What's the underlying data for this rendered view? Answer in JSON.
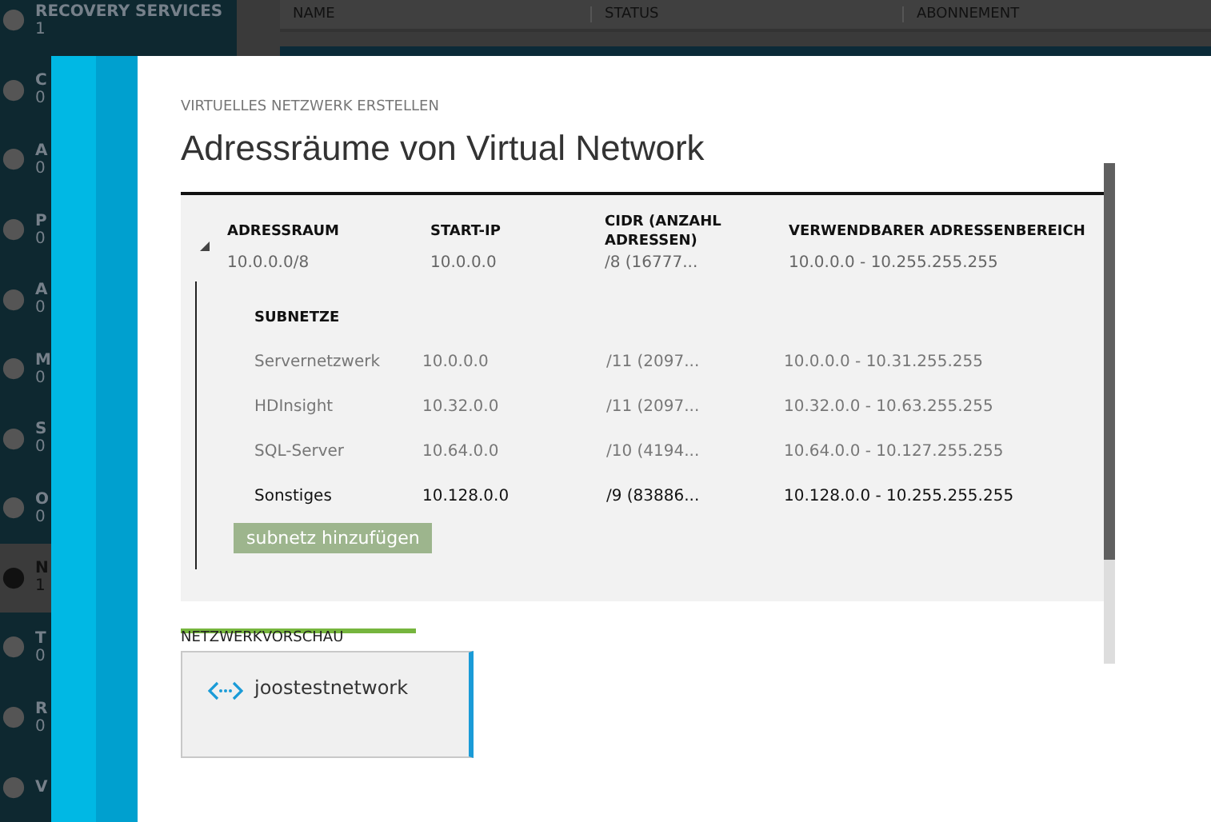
{
  "background": {
    "sidebar": [
      {
        "label": "RECOVERY SERVICES",
        "count": "1",
        "selected": false
      },
      {
        "label": "C",
        "count": "0",
        "selected": false
      },
      {
        "label": "A",
        "count": "0",
        "selected": false
      },
      {
        "label": "P",
        "count": "0",
        "selected": false
      },
      {
        "label": "A",
        "count": "0",
        "selected": false
      },
      {
        "label": "M",
        "count": "0",
        "selected": false
      },
      {
        "label": "S",
        "count": "0",
        "selected": false
      },
      {
        "label": "O",
        "count": "0",
        "selected": false
      },
      {
        "label": "N",
        "count": "1",
        "selected": true
      },
      {
        "label": "T",
        "count": "0",
        "selected": false
      },
      {
        "label": "R",
        "count": "0",
        "selected": false
      },
      {
        "label": "V",
        "selected": false
      }
    ],
    "list_columns": [
      "NAME",
      "STATUS",
      "ABONNEMENT"
    ]
  },
  "dialog": {
    "breadcrumb": "VIRTUELLES NETZWERK ERSTELLEN",
    "title": "Adressräume von Virtual Network",
    "address_table": {
      "columns": [
        "ADRESSRAUM",
        "START-IP",
        "CIDR (ANZAHL ADRESSEN)",
        "VERWENDBARER ADRESSENBEREICH"
      ],
      "rows": [
        {
          "expanded": true,
          "cells": [
            "10.0.0.0/8",
            "10.0.0.0",
            "/8 (16777...",
            "10.0.0.0 - 10.255.255.255"
          ],
          "subnets_heading": "SUBNETZE",
          "subnets": [
            {
              "highlighted": false,
              "cells": [
                "Servernetzwerk",
                "10.0.0.0",
                "/11 (2097...",
                "10.0.0.0 - 10.31.255.255"
              ]
            },
            {
              "highlighted": false,
              "cells": [
                "HDInsight",
                "10.32.0.0",
                "/11 (2097...",
                "10.32.0.0 - 10.63.255.255"
              ]
            },
            {
              "highlighted": false,
              "cells": [
                "SQL-Server",
                "10.64.0.0",
                "/10 (4194...",
                "10.64.0.0 - 10.127.255.255"
              ]
            },
            {
              "highlighted": true,
              "cells": [
                "Sonstiges",
                "10.128.0.0",
                "/9 (83886...",
                "10.128.0.0 - 10.255.255.255"
              ]
            }
          ],
          "add_button": "subnetz hinzufügen"
        }
      ]
    },
    "preview": {
      "heading": "NETZWERKVORSCHAU",
      "network_name": "joostestnetwork"
    }
  }
}
